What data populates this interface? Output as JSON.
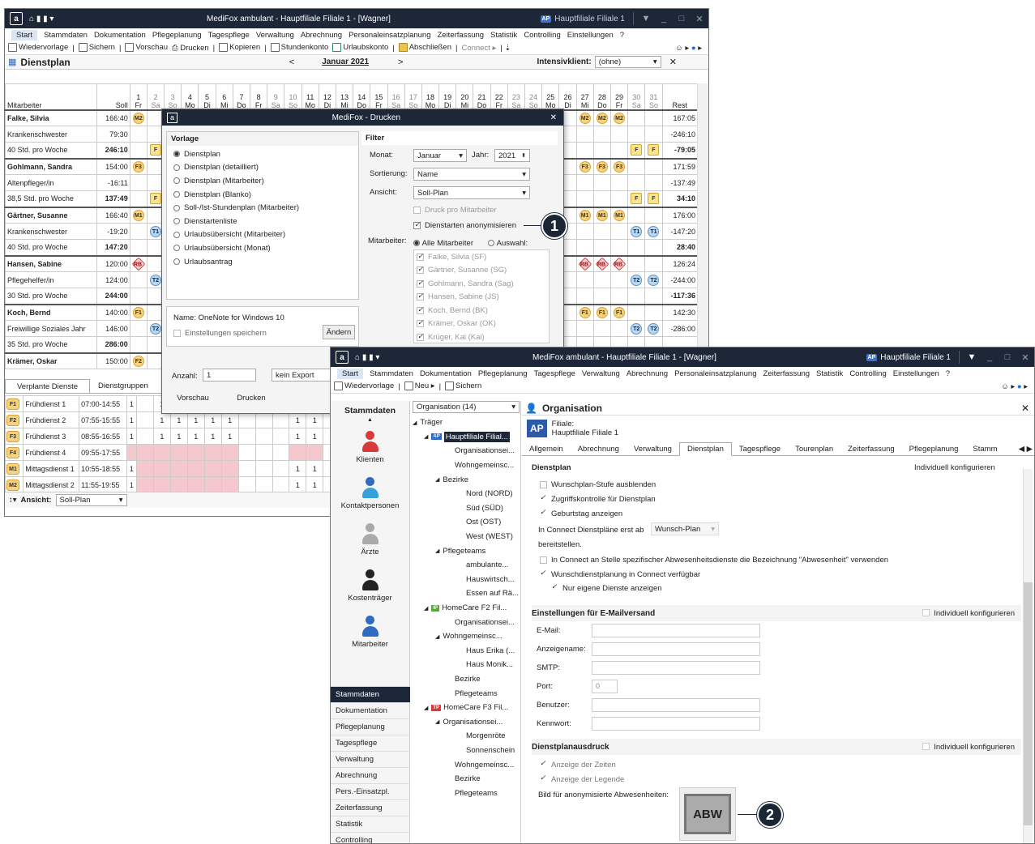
{
  "win1": {
    "title": "MediFox ambulant - Hauptfiliale Filiale 1 - [Wagner]",
    "badge": "AP",
    "branch": "Hauptfiliale Filiale 1"
  },
  "menu": [
    "Start",
    "Stammdaten",
    "Dokumentation",
    "Pflegeplanung",
    "Tagespflege",
    "Verwaltung",
    "Abrechnung",
    "Personaleinsatzplanung",
    "Zeiterfassung",
    "Statistik",
    "Controlling",
    "Einstellungen",
    "?"
  ],
  "toolbar1": [
    "Wiedervorlage",
    "Sichern",
    "Vorschau",
    "Drucken",
    "Kopieren",
    "Stundenkonto",
    "Urlaubskonto",
    "Abschließen",
    "Connect ▸"
  ],
  "dienstplan": {
    "title": "Dienstplan",
    "month": "Januar 2021",
    "intensiv_label": "Intensivklient:",
    "intensiv_value": "(ohne)",
    "col_mitarbeiter": "Mitarbeiter",
    "col_soll": "Soll",
    "col_rest": "Rest",
    "days": [
      "1",
      "2",
      "3",
      "4",
      "5",
      "6",
      "7",
      "8",
      "9",
      "10",
      "11",
      "12",
      "13",
      "14",
      "15",
      "16",
      "17",
      "18",
      "19",
      "20",
      "21",
      "22",
      "23",
      "24",
      "25",
      "26",
      "27",
      "28",
      "29",
      "30",
      "31"
    ],
    "wd": [
      "Fr",
      "Sa",
      "So",
      "Mo",
      "Di",
      "Mi",
      "Do",
      "Fr",
      "Sa",
      "So",
      "Mo",
      "Di",
      "Mi",
      "Do",
      "Fr",
      "Sa",
      "So",
      "Mo",
      "Di",
      "Mi",
      "Do",
      "Fr",
      "Sa",
      "So",
      "Mo",
      "Di",
      "Mi",
      "Do",
      "Fr",
      "Sa",
      "So"
    ],
    "rows": [
      {
        "name": "Falke, Silvia",
        "soll": "166:40",
        "rest": "167:05",
        "bold": true,
        "left": "M2",
        "right": [
          "M2",
          "M2",
          "M2"
        ],
        "rc": "m2"
      },
      {
        "name": "Krankenschwester",
        "soll": "79:30",
        "rest": "-246:10"
      },
      {
        "name": "40 Std. pro Woche",
        "soll": "246:10",
        "rest": "-79:05",
        "sb": true,
        "f": true
      },
      {
        "name": "Gohlmann, Sandra",
        "soll": "154:00",
        "rest": "171:59",
        "bold": true,
        "left": "F3",
        "right": [
          "F3",
          "F3",
          "F3"
        ],
        "rc": "m2"
      },
      {
        "name": "Altenpfleger/in",
        "soll": "-16:11",
        "rest": "-137:49"
      },
      {
        "name": "38,5 Std. pro Woche",
        "soll": "137:49",
        "rest": "34:10",
        "sb": true,
        "f": true
      },
      {
        "name": "Gärtner, Susanne",
        "soll": "166:40",
        "rest": "176:00",
        "bold": true,
        "left": "M1",
        "right": [
          "M1",
          "M1",
          "M1"
        ],
        "rc": "m2"
      },
      {
        "name": "Krankenschwester",
        "soll": "-19:20",
        "rest": "-147:20",
        "t": "T1"
      },
      {
        "name": "40 Std. pro Woche",
        "soll": "147:20",
        "rest": "28:40",
        "sb": true
      },
      {
        "name": "Hansen, Sabine",
        "soll": "120:00",
        "rest": "126:24",
        "bold": true,
        "left": "RB",
        "right": [
          "RB",
          "RB",
          "RB"
        ],
        "rc": "rb"
      },
      {
        "name": "Pflegehelfer/in",
        "soll": "124:00",
        "rest": "-244:00",
        "t": "T2"
      },
      {
        "name": "30 Std. pro Woche",
        "soll": "244:00",
        "rest": "-117:36",
        "sb": true
      },
      {
        "name": "Koch, Bernd",
        "soll": "140:00",
        "rest": "142:30",
        "bold": true,
        "left": "F1",
        "right": [
          "F1",
          "F1",
          "F1"
        ],
        "rc": "m2"
      },
      {
        "name": "Freiwillige Soziales Jahr",
        "soll": "146:00",
        "rest": "-286:00",
        "t": "T2"
      },
      {
        "name": "35 Std. pro Woche",
        "soll": "286:00",
        "rest": "",
        "sb": true
      },
      {
        "name": "Krämer, Oskar",
        "soll": "150:00",
        "rest": "",
        "bold": true,
        "left": "F2"
      }
    ],
    "tabs": [
      "Verplante Dienste",
      "Dienstgruppen"
    ],
    "dienste": [
      {
        "code": "F1",
        "name": "Frühdienst 1",
        "time": "07:00-14:55",
        "n": "1"
      },
      {
        "code": "F2",
        "name": "Frühdienst 2",
        "time": "07:55-15:55",
        "n": "1"
      },
      {
        "code": "F3",
        "name": "Frühdienst 3",
        "time": "08:55-16:55",
        "n": "1"
      },
      {
        "code": "F4",
        "name": "Frühdienst 4",
        "time": "09:55-17:55",
        "n": ""
      },
      {
        "code": "M1",
        "name": "Mittagsdienst 1",
        "time": "10:55-18:55",
        "n": "1"
      },
      {
        "code": "M2",
        "name": "Mittagsdienst 2",
        "time": "11:55-19:55",
        "n": "1"
      }
    ],
    "view_label": "Ansicht:",
    "view_value": "Soll-Plan"
  },
  "print": {
    "title": "MediFox - Drucken",
    "vorlage": "Vorlage",
    "options": [
      "Dienstplan",
      "Dienstplan (detailliert)",
      "Dienstplan (Mitarbeiter)",
      "Dienstplan (Blanko)",
      "Soll-/Ist-Stundenplan (Mitarbeiter)",
      "Dienstartenliste",
      "Urlaubsübersicht (Mitarbeiter)",
      "Urlaubsübersicht (Monat)",
      "Urlaubsantrag"
    ],
    "filter": "Filter",
    "monat_l": "Monat:",
    "monat": "Januar",
    "jahr_l": "Jahr:",
    "jahr": "2021",
    "sort_l": "Sortierung:",
    "sort": "Name",
    "ansicht_l": "Ansicht:",
    "ansicht": "Soll-Plan",
    "druck_pro": "Druck pro Mitarbeiter",
    "anonym": "Dienstarten anonymisieren",
    "ma_l": "Mitarbeiter:",
    "alle": "Alle Mitarbeiter",
    "auswahl": "Auswahl:",
    "ma": [
      "Falke, Silvia (SF)",
      "Gärtner, Susanne (SG)",
      "Gohlmann, Sandra (Sag)",
      "Hansen, Sabine (JS)",
      "Koch, Bernd (BK)",
      "Krämer, Oskar (OK)",
      "Krüger, Kai (Kai)"
    ],
    "printer": "Name: OneNote for Windows 10",
    "save": "Einstellungen speichern",
    "aendern": "Ändern",
    "anzahl_l": "Anzahl:",
    "anzahl": "1",
    "export": "kein Export",
    "vorschau": "Vorschau",
    "drucken": "Drucken"
  },
  "callouts": [
    "1",
    "2"
  ],
  "win2": {
    "title": "MediFox ambulant - Hauptfiliale Filiale 1 - [Wagner]",
    "badge": "AP",
    "branch": "Hauptfiliale Filiale 1",
    "toolbar": [
      "Wiedervorlage",
      "Neu ▸",
      "Sichern"
    ],
    "side_title": "Stammdaten",
    "side_icons": [
      "Klienten",
      "Kontaktpersonen",
      "Ärzte",
      "Kostenträger",
      "Mitarbeiter"
    ],
    "nav": [
      "Stammdaten",
      "Dokumentation",
      "Pflegeplanung",
      "Tagespflege",
      "Verwaltung",
      "Abrechnung",
      "Pers.-Einsatzpl.",
      "Zeiterfassung",
      "Statistik",
      "Controlling"
    ],
    "org_select": "Organisation (14)",
    "tree": [
      {
        "t": "◢ ",
        "l": "Träger",
        "d": 0
      },
      {
        "t": "◢ ",
        "l": "Hauptfiliale Filial...",
        "d": 1,
        "ap": "AP",
        "sel": true
      },
      {
        "l": "Organisationsei...",
        "d": 3
      },
      {
        "l": "Wohngemeinsc...",
        "d": 3
      },
      {
        "t": "◢ ",
        "l": "Bezirke",
        "d": 2
      },
      {
        "l": "Nord (NORD)",
        "d": 4
      },
      {
        "l": "Süd (SÜD)",
        "d": 4
      },
      {
        "l": "Ost (OST)",
        "d": 4
      },
      {
        "l": "West (WEST)",
        "d": 4
      },
      {
        "t": "◢ ",
        "l": "Pflegeteams",
        "d": 2
      },
      {
        "l": "ambulante...",
        "d": 4
      },
      {
        "l": "Hauswirtsch...",
        "d": 4
      },
      {
        "l": "Essen auf Rä...",
        "d": 4
      },
      {
        "t": "◢ ",
        "l": "HomeCare F2 Fil...",
        "d": 1,
        "ap": "IP"
      },
      {
        "l": "Organisationsei...",
        "d": 3
      },
      {
        "t": "◢ ",
        "l": "Wohngemeinsc...",
        "d": 2
      },
      {
        "l": "Haus Erika (...",
        "d": 4
      },
      {
        "l": "Haus Monik...",
        "d": 4
      },
      {
        "l": "Bezirke",
        "d": 3
      },
      {
        "l": "Pflegeteams",
        "d": 3
      },
      {
        "t": "◢ ",
        "l": "HomeCare F3 Fil...",
        "d": 1,
        "ap": "TP"
      },
      {
        "t": "◢ ",
        "l": "Organisationsei...",
        "d": 2
      },
      {
        "l": "Morgenröte",
        "d": 4
      },
      {
        "l": "Sonnenschein",
        "d": 4
      },
      {
        "l": "Wohngemeinsc...",
        "d": 3
      },
      {
        "l": "Bezirke",
        "d": 3
      },
      {
        "l": "Pflegeteams",
        "d": 3
      }
    ],
    "org_title": "Organisation",
    "filiale_l": "Filiale:",
    "filiale": "Hauptfiliale Filiale 1",
    "tabs": [
      "Allgemein",
      "Abrechnung",
      "Verwaltung",
      "Dienstplan",
      "Tagespflege",
      "Tourenplan",
      "Zeiterfassung",
      "Pflegeplanung",
      "Stamm"
    ],
    "cut_head": "Dienstplan",
    "indiv_cut": "Individuell konfigurieren",
    "opts": [
      "Wunschplan-Stufe ausblenden",
      "Zugriffskontrolle für Dienstplan",
      "Geburtstag anzeigen"
    ],
    "connect_l": "In Connect Dienstpläne erst ab",
    "connect_v": "Wunsch-Plan",
    "bereit": "bereitstellen.",
    "opt2": "In Connect an Stelle spezifischer Abwesenheitsdienste die Bezeichnung \"Abwesenheit\" verwenden",
    "opt3": "Wunschdienstplanung in Connect verfügbar",
    "opt4": "Nur eigene Dienste anzeigen",
    "mail_h": "Einstellungen für E-Mailversand",
    "indiv": "Individuell konfigurieren",
    "mail_fields": [
      "E-Mail:",
      "Anzeigename:",
      "SMTP:",
      "Port:",
      "Benutzer:",
      "Kennwort:"
    ],
    "port": "0",
    "druck_h": "Dienstplanausdruck",
    "druck_opts": [
      "Anzeige der Zeiten",
      "Anzeige der Legende"
    ],
    "bild_l": "Bild für anonymisierte Abwesenheiten:",
    "abw": "ABW"
  }
}
